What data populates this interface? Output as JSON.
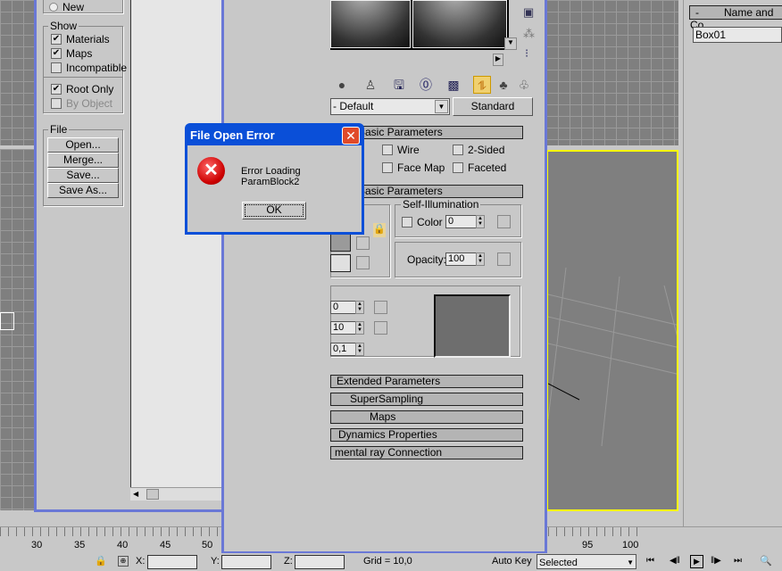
{
  "left_browser": {
    "new_label": "New",
    "show_label": "Show",
    "show_items": [
      {
        "label": "Materials",
        "checked": true
      },
      {
        "label": "Maps",
        "checked": true
      },
      {
        "label": "Incompatible",
        "checked": false
      }
    ],
    "root_only": {
      "label": "Root Only",
      "checked": true
    },
    "by_object": {
      "label": "By Object",
      "checked": false
    },
    "file_label": "File",
    "file_buttons": [
      "Open...",
      "Merge...",
      "Save...",
      "Save As..."
    ]
  },
  "material_editor": {
    "material_name": "- Default",
    "type_button": "Standard",
    "basic_params_title": "Basic Parameters",
    "shader_options": [
      "Wire",
      "2-Sided",
      "Face Map",
      "Faceted"
    ],
    "blinn_title": "Basic Parameters",
    "self_illum_label": "Self-Illumination",
    "color_label": "Color",
    "color_value": "0",
    "opacity_label": "Opacity:",
    "opacity_value": "100",
    "spec_values": [
      "0",
      "10",
      "0,1"
    ],
    "rollouts": [
      "Extended Parameters",
      "SuperSampling",
      "Maps",
      "Dynamics Properties",
      "mental ray Connection"
    ]
  },
  "dialog": {
    "title": "File Open Error",
    "message": "Error Loading ParamBlock2",
    "ok_label": "OK"
  },
  "command_panel": {
    "rollout_title": "Name and Co",
    "collapse": "-",
    "object_name": "Box01"
  },
  "timeline": {
    "ticks_left": [
      "30",
      "35",
      "40",
      "45",
      "50"
    ],
    "ticks_right": [
      "95",
      "100"
    ]
  },
  "status_bar": {
    "x_label": "X:",
    "y_label": "Y:",
    "z_label": "Z:",
    "grid": "Grid = 10,0",
    "auto_key": "Auto Key",
    "selected": "Selected"
  }
}
